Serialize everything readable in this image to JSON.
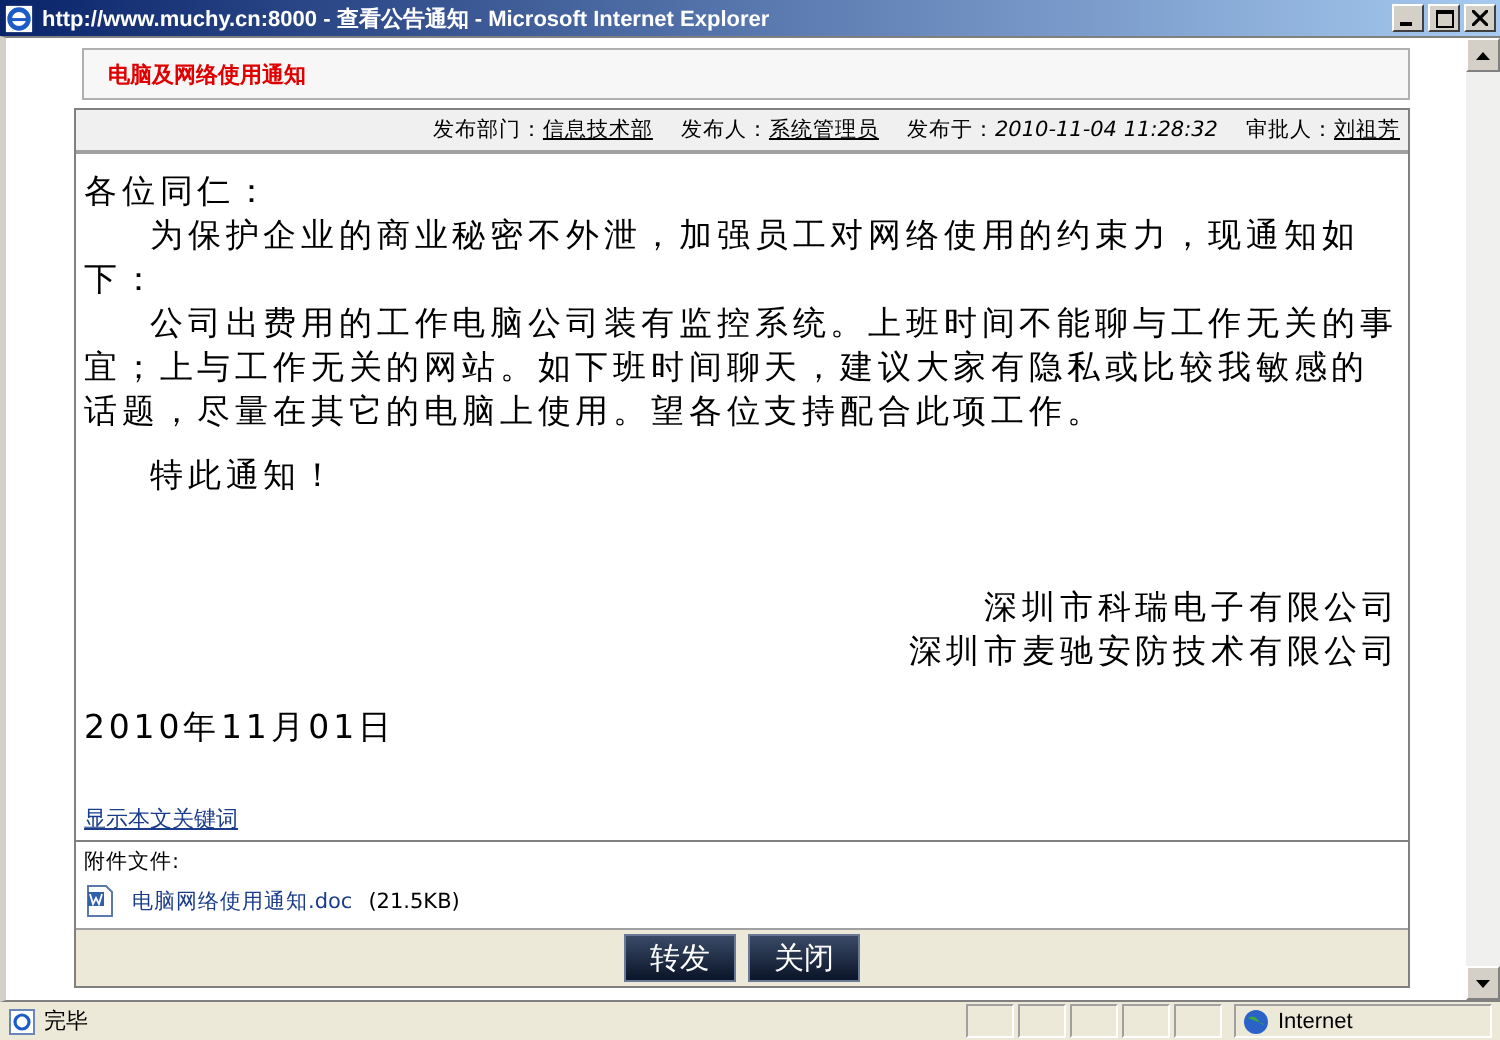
{
  "window": {
    "title": "http://www.muchy.cn:8000 - 查看公告通知 - Microsoft Internet Explorer"
  },
  "notice_title": "电脑及网络使用通知",
  "meta": [
    {
      "label": "发布部门：",
      "value": "信息技术部",
      "kind": "link"
    },
    {
      "label": "发布人：",
      "value": "系统管理员",
      "kind": "link"
    },
    {
      "label": "发布于：",
      "value": "2010-11-04 11:28:32",
      "kind": "date"
    },
    {
      "label": "审批人：",
      "value": "刘祖芳",
      "kind": "link"
    }
  ],
  "greeting": "各位同仁：",
  "paragraphs": [
    "为保护企业的商业秘密不外泄，加强员工对网络使用的约束力，现通知如下：",
    "公司出费用的工作电脑公司装有监控系统。上班时间不能聊与工作无关的事宜；上与工作无关的网站。如下班时间聊天，建议大家有隐私或比较我敏感的话题，尽量在其它的电脑上使用。望各位支持配合此项工作。"
  ],
  "closing": "特此通知！",
  "signatures": [
    "深圳市科瑞电子有限公司",
    "深圳市麦驰安防技术有限公司"
  ],
  "date": "2010年11月01日",
  "keywords_link": "显示本文关键词",
  "attachments": {
    "label": "附件文件:",
    "files": [
      {
        "name": "电脑网络使用通知.doc",
        "size": "(21.5KB)"
      }
    ]
  },
  "buttons": [
    "转发",
    "关闭"
  ],
  "status_bar": {
    "text": "完毕",
    "zone": "Internet"
  }
}
